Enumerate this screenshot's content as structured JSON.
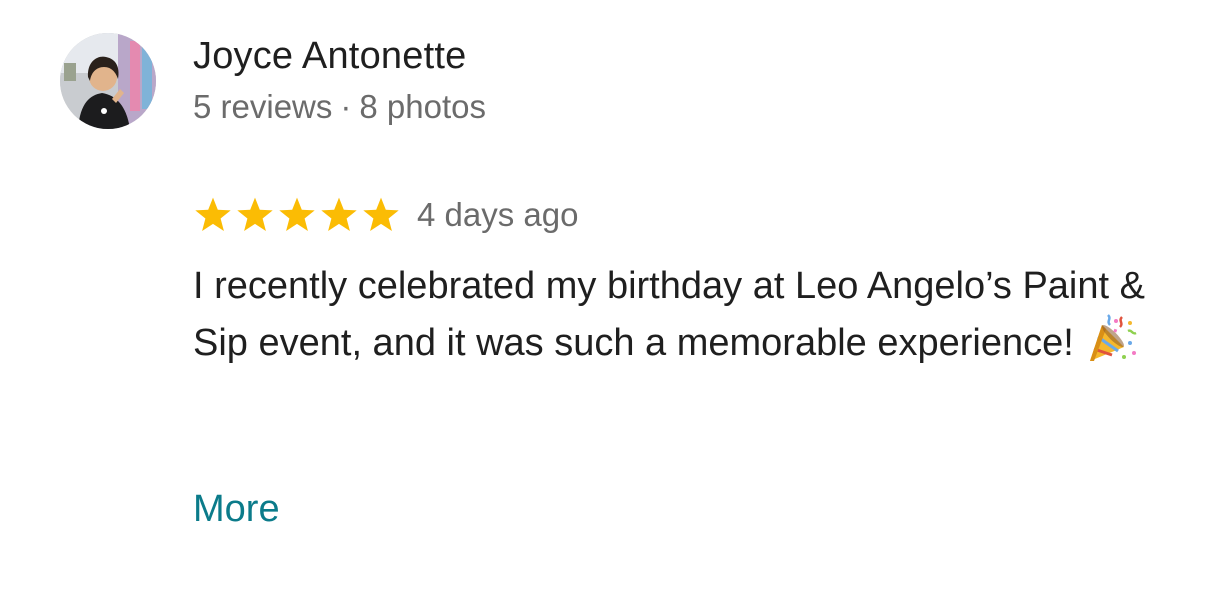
{
  "reviewer": {
    "name": "Joyce Antonette",
    "reviews": "5 reviews",
    "separator": "·",
    "photos": "8 photos",
    "avatar_icon": "profile-photo"
  },
  "review": {
    "rating": 5,
    "rating_max": 5,
    "star_color": "#fbbc04",
    "date": "4 days ago",
    "text": "I recently celebrated my birthday at Leo Angelo’s Paint & Sip event, and it was such a memorable experience!",
    "emoji_icon": "party-popper-icon"
  },
  "actions": {
    "more_label": "More",
    "link_color": "#0b7b8a"
  }
}
